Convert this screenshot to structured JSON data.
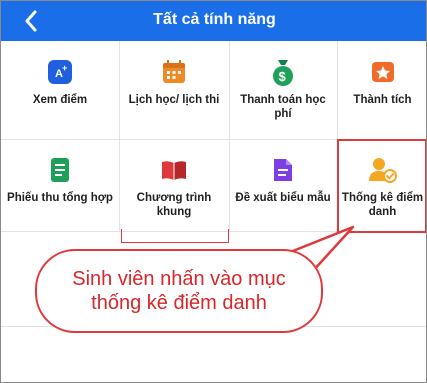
{
  "header": {
    "title": "Tất cả tính năng"
  },
  "tiles": [
    {
      "label": "Xem điểm",
      "icon": "score-icon",
      "color": "#1f5fe0"
    },
    {
      "label": "Lịch học/ lịch thi",
      "icon": "calendar-icon",
      "color": "#f08a24"
    },
    {
      "label": "Thanh toán học phí",
      "icon": "money-bag-icon",
      "color": "#1ea05a"
    },
    {
      "label": "Thành tích",
      "icon": "achievement-icon",
      "color": "#f06a2a"
    },
    {
      "label": "Phiếu thu tổng hợp",
      "icon": "receipt-icon",
      "color": "#1ea05a"
    },
    {
      "label": "Chương trình khung",
      "icon": "book-icon",
      "color": "#e0393c"
    },
    {
      "label": "Đề xuất biểu mẫu",
      "icon": "document-icon",
      "color": "#7b3fe4"
    },
    {
      "label": "Thống kê điểm danh",
      "icon": "attendance-icon",
      "color": "#f5a623"
    }
  ],
  "callout": {
    "line1": "Sinh viên nhấn vào mục",
    "line2": "thống kê điểm danh"
  },
  "colors": {
    "header_bg": "#1a6fe8",
    "highlight": "#e0393c",
    "callout_text": "#d9262b"
  }
}
